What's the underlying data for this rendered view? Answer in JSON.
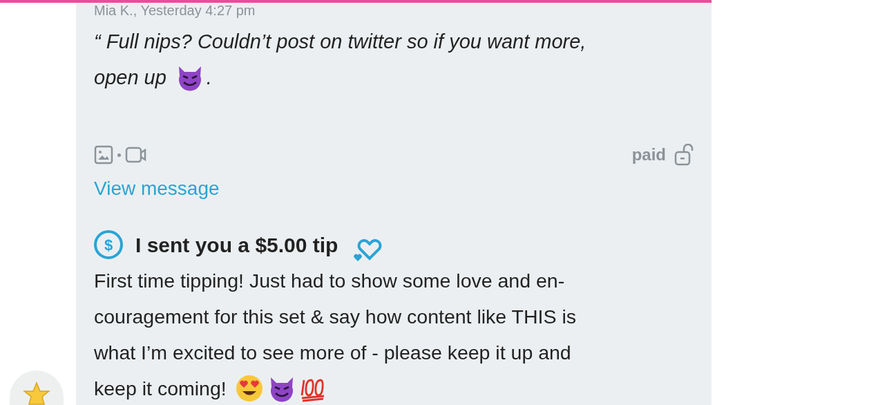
{
  "message": {
    "sender_line": "Mia K., Yesterday 4:27 pm",
    "text_lines": [
      "“ Full nips? Couldn’t post on twitter so if you want more,",
      "open up"
    ],
    "text_end": ".",
    "price_status": "paid",
    "link": "View message"
  },
  "tip": {
    "icon_glyph": "$",
    "title": "I sent you a $5.00 tip",
    "body_lines": [
      "First time tipping! Just had to show some love and en-",
      "couragement for this set & say how content like THIS is",
      "what I’m excited to see more of - please keep it up and",
      "keep it coming!"
    ]
  }
}
